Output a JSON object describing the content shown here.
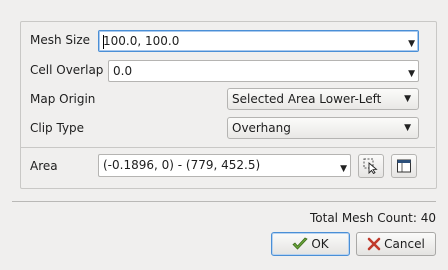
{
  "fields": {
    "mesh_size": {
      "label": "Mesh Size",
      "value": "100.0, 100.0"
    },
    "cell_overlap": {
      "label": "Cell Overlap",
      "value": "0.0"
    },
    "map_origin": {
      "label": "Map Origin",
      "value": "Selected Area Lower-Left"
    },
    "clip_type": {
      "label": "Clip Type",
      "value": "Overhang"
    },
    "area": {
      "label": "Area",
      "value": "(-0.1896, 0) - (779, 452.5)"
    }
  },
  "total_mesh_count": "Total Mesh Count: 40",
  "buttons": {
    "ok": "OK",
    "cancel": "Cancel"
  },
  "icons": {
    "area_select": "pointer-select-icon",
    "area_window": "window-icon",
    "ok": "checkmark-icon",
    "cancel": "x-icon"
  }
}
